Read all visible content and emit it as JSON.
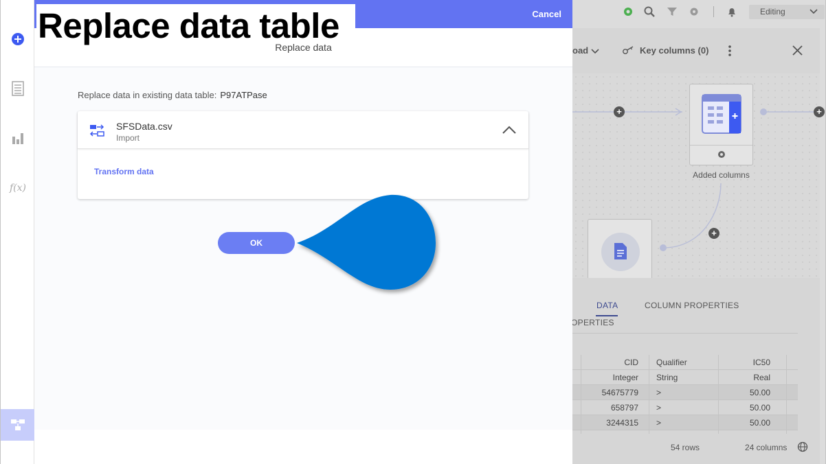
{
  "overlay": {
    "title": "Replace data table"
  },
  "modal": {
    "cancel_label": "Cancel",
    "subheader": "Replace data",
    "replace_label": "Replace data in existing data table:",
    "table_name": "P97ATPase",
    "source": {
      "file_name": "SFSData.csv",
      "type": "Import",
      "transform_label": "Transform data"
    },
    "ok_label": "OK"
  },
  "rail": {
    "icons": [
      "add-icon",
      "page-icon",
      "bar-chart-icon",
      "function-icon",
      "data-canvas-icon"
    ]
  },
  "background": {
    "mode_label": "Editing",
    "load_label": "oad",
    "key_columns_label": "Key columns (0)",
    "node_label": "Added columns",
    "tabs": [
      "DATA",
      "COLUMN PROPERTIES"
    ],
    "tab_partial": "OPERTIES",
    "table": {
      "headers": [
        "CID",
        "Qualifier",
        "IC50"
      ],
      "types": [
        "Integer",
        "String",
        "Real"
      ],
      "rows": [
        [
          "54675779",
          ">",
          "50.00"
        ],
        [
          "658797",
          ">",
          "50.00"
        ],
        [
          "3244315",
          ">",
          "50.00"
        ]
      ]
    },
    "rows_label": "54 rows",
    "columns_label": "24 columns"
  },
  "colors": {
    "accent": "#6273f2",
    "ok_button": "#6b7ef3",
    "callout": "#0078d4"
  }
}
